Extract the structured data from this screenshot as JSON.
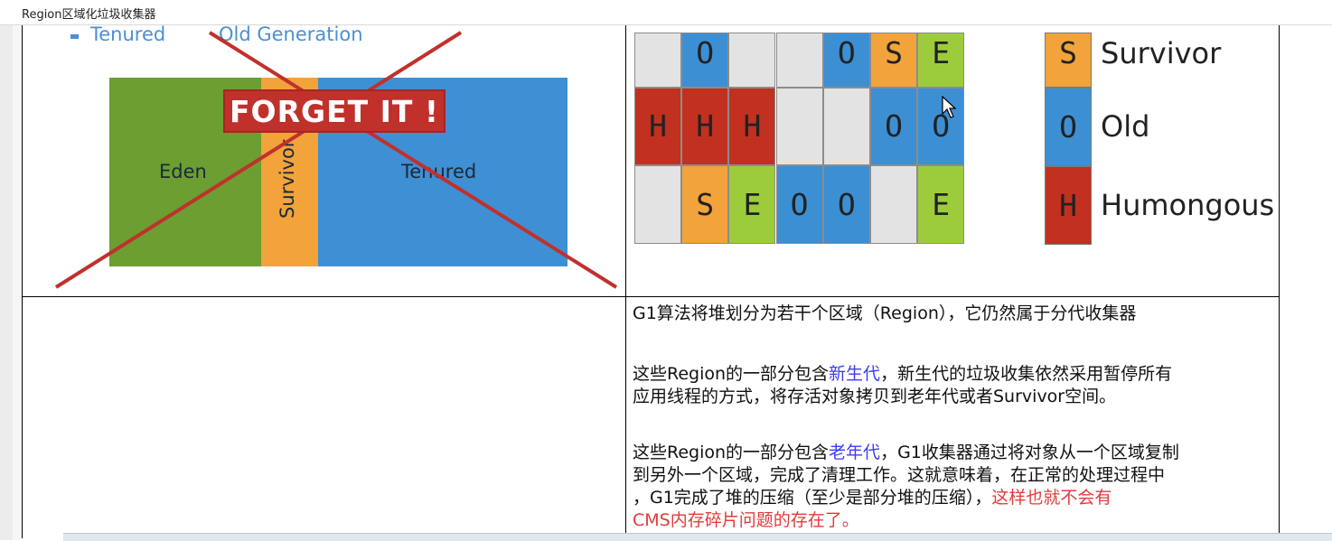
{
  "window": {
    "title": "Region区域化垃圾收集器"
  },
  "left_figure": {
    "bullet_items": [
      "Tenured",
      "Old Generation"
    ],
    "heap_regions": [
      "Eden",
      "Survivor",
      "Tenured"
    ],
    "overlay_text": "FORGET IT !"
  },
  "region_grid": {
    "rows": [
      [
        "",
        "O",
        "",
        "",
        "O",
        "S",
        "E"
      ],
      [
        "H",
        "H",
        "H",
        "",
        "",
        "O",
        "O"
      ],
      [
        "",
        "S",
        "E",
        "O",
        "O",
        "",
        "E"
      ]
    ],
    "colors": {
      "E": "#9ccc3c",
      "S": "#f2a33b",
      "O": "#3d8fd4",
      "H": "#c2301f",
      "": "#e3e3e3"
    }
  },
  "legend": [
    {
      "letter": "S",
      "label": "Survivor",
      "color": "#f2a33b"
    },
    {
      "letter": "O",
      "label": "Old",
      "color": "#3d8fd4"
    },
    {
      "letter": "H",
      "label": "Humongous",
      "color": "#c2301f"
    }
  ],
  "description": {
    "p1": "G1算法将堆划分为若干个区域（Region），它仍然属于分代收集器",
    "p2_line1_a": "这些Region的一部分包含",
    "p2_line1_b": "新生代",
    "p2_line1_c": "，新生代的垃圾收集依然采用暂停所有",
    "p2_line2": "应用线程的方式，将存活对象拷贝到老年代或者Survivor空间。",
    "p3_line1_a": "这些Region的一部分包含",
    "p3_line1_b": "老年代",
    "p3_line1_c": "，G1收集器通过将对象从一个区域复制",
    "p3_line2": "到另外一个区域，完成了清理工作。这就意味着，在正常的处理过程中",
    "p3_line3_a": "，G1完成了堆的压缩（至少是部分堆的压缩），",
    "p3_line3_b": "这样也就不会有",
    "p3_line4": "CMS内存碎片问题的存在了。"
  }
}
